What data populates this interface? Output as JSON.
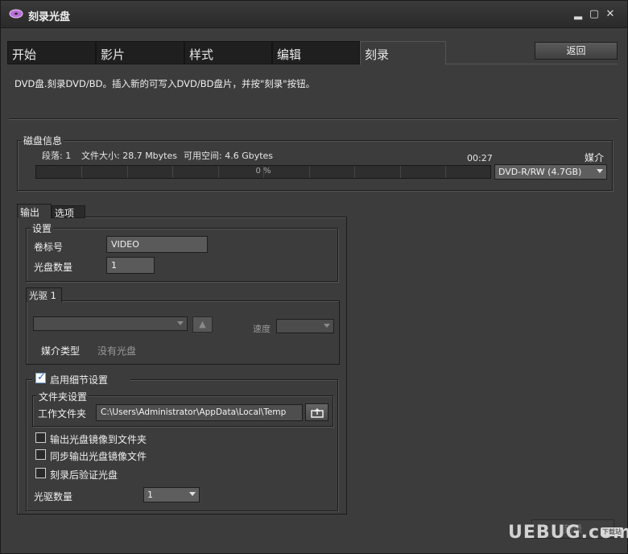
{
  "window": {
    "title": "刻录光盘",
    "minimize": "▂",
    "maximize": "▢",
    "close": "✕"
  },
  "tabs": [
    {
      "label": "开始",
      "active": false
    },
    {
      "label": "影片",
      "active": false
    },
    {
      "label": "样式",
      "active": false
    },
    {
      "label": "编辑",
      "active": false
    },
    {
      "label": "刻录",
      "active": true
    }
  ],
  "back_button": "返回",
  "description": "DVD盘.刻录DVD/BD。插入新的可写入DVD/BD盘片，并按\"刻录\"按钮。",
  "disc_info": {
    "group_label": "磁盘信息",
    "segments": "段落: 1",
    "file_size": "文件大小: 28.7 Mbytes",
    "free_space": "可用空间: 4.6 Gbytes",
    "time": "00:27",
    "media_label": "媒介",
    "progress_text": "0 %",
    "progress_fraction": 0,
    "media_select": "DVD-R/RW (4.7GB)"
  },
  "sub_tabs": [
    {
      "label": "输出",
      "active": true
    },
    {
      "label": "选项",
      "active": false
    }
  ],
  "settings": {
    "group_label": "设置",
    "volume_label": "卷标号",
    "volume_value": "VIDEO",
    "disc_count_label": "光盘数量",
    "disc_count_value": "1"
  },
  "drive": {
    "tab_label": "光驱 1",
    "drive_select": "",
    "eject_icon": "▲",
    "speed_label": "速度",
    "speed_select": "",
    "media_type_label": "媒介类型",
    "media_type_value": "没有光盘"
  },
  "details": {
    "enable_label": "启用细节设置",
    "enable_checked": true,
    "folder_group_label": "文件夹设置",
    "work_folder_label": "工作文件夹",
    "work_folder_value": "C:\\Users\\Administrator\\AppData\\Local\\Temp",
    "browse_icon": "folder-browse-icon",
    "options": [
      {
        "label": "输出光盘镜像到文件夹",
        "checked": false
      },
      {
        "label": "同步输出光盘镜像文件",
        "checked": false
      },
      {
        "label": "刻录后验证光盘",
        "checked": false
      }
    ],
    "drive_count_label": "光驱数量",
    "drive_count_value": "1"
  },
  "burn_button": "刻录",
  "watermark": {
    "text": "UEBUG.com",
    "tag": "下载站"
  },
  "colors": {
    "window_bg": "#3c3c3c",
    "tab_inactive": "#1f1f1f",
    "check_blue": "#2c6bc2"
  }
}
